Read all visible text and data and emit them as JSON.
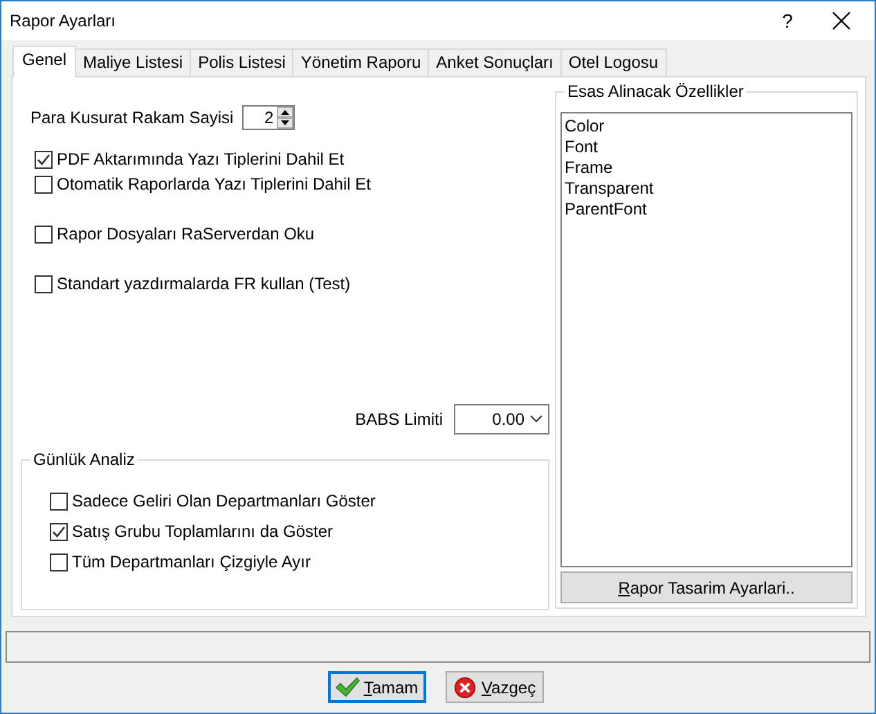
{
  "window": {
    "title": "Rapor Ayarları",
    "help": "?"
  },
  "tabs": [
    {
      "label": "Genel",
      "selected": true
    },
    {
      "label": "Maliye Listesi",
      "selected": false
    },
    {
      "label": "Polis Listesi",
      "selected": false
    },
    {
      "label": "Yönetim Raporu",
      "selected": false
    },
    {
      "label": "Anket Sonuçları",
      "selected": false
    },
    {
      "label": "Otel Logosu",
      "selected": false
    }
  ],
  "decimal_digits": {
    "label": "Para Kusurat Rakam Sayisi",
    "value": "2"
  },
  "options": [
    {
      "label": "PDF Aktarımında Yazı Tiplerini Dahil Et",
      "checked": true
    },
    {
      "label": "Otomatik Raporlarda Yazı Tiplerini Dahil Et",
      "checked": false
    },
    {
      "label": "Rapor Dosyaları RaServerdan Oku",
      "checked": false
    },
    {
      "label": "Standart yazdırmalarda FR kullan (Test)",
      "checked": false
    }
  ],
  "babs_limit": {
    "label": "BABS Limiti",
    "value": "0.00"
  },
  "daily_analysis": {
    "title": "Günlük Analiz",
    "options": [
      {
        "label": "Sadece Geliri Olan Departmanları Göster",
        "checked": false
      },
      {
        "label": "Satış Grubu Toplamlarını da Göster",
        "checked": true
      },
      {
        "label": "Tüm Departmanları Çizgiyle Ayır",
        "checked": false
      }
    ]
  },
  "properties": {
    "title": "Esas Alinacak Özellikler",
    "items": [
      "Color",
      "Font",
      "Frame",
      "Transparent",
      "ParentFont"
    ],
    "button": {
      "label": "Rapor Tasarim Ayarlari.."
    }
  },
  "buttons": [
    {
      "kind": "ok",
      "label": "Tamam",
      "default": true
    },
    {
      "kind": "cancel",
      "label": "Vazgeç",
      "default": false
    }
  ]
}
